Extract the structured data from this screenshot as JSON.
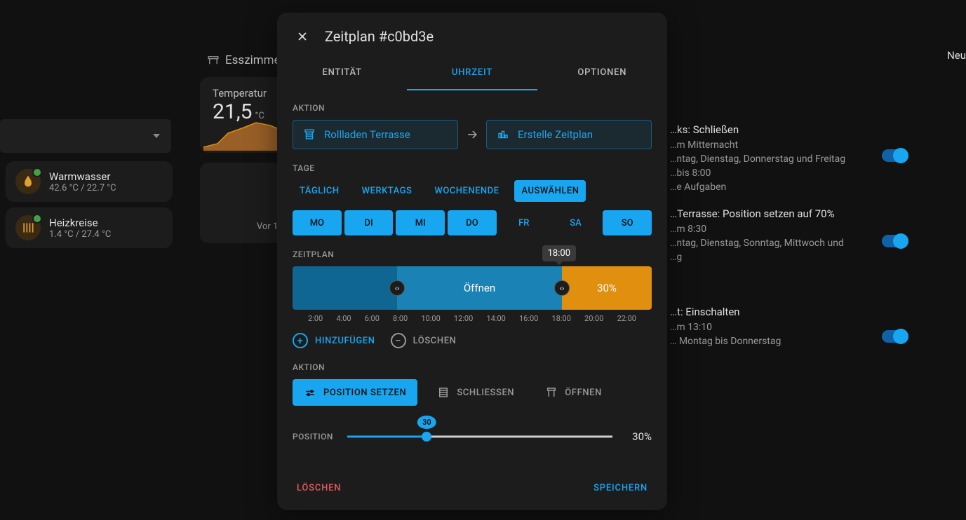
{
  "bg": {
    "room": "Esszimmer",
    "neu": "Neu",
    "temp_label": "Temperatur",
    "temp_value": "21,5",
    "temp_unit": "°C",
    "mid_time": "Vor 1…",
    "sensors": {
      "ww": {
        "name": "Warmwasser",
        "sub": "42.6 °C / 22.7 °C"
      },
      "hk": {
        "name": "Heizkreise",
        "sub": "1.4 °C / 27.4 °C"
      }
    },
    "schedules": {
      "r1": {
        "title": "…ks: Schließen",
        "l1": "…m Mitternacht",
        "l2": "…ntag, Dienstag, Donnerstag und Freitag",
        "l3": "…bis 8:00",
        "l4": "…e Aufgaben"
      },
      "r2": {
        "title": "…Terrasse: Position setzen auf 70%",
        "l1": "…m 8:30",
        "l2": "…ntag, Dienstag, Sonntag, Mittwoch und",
        "l3": "…g"
      },
      "r3": {
        "title": "…t: Einschalten",
        "l1": "…m 13:10",
        "l2": "… Montag bis Donnerstag"
      }
    }
  },
  "dialog": {
    "title": "Zeitplan #c0bd3e",
    "tabs": {
      "entity": "ENTITÄT",
      "time": "UHRZEIT",
      "options": "OPTIONEN"
    },
    "section_action": "AKTION",
    "chip_entity": "Rollladen Terrasse",
    "chip_make": "Erstelle Zeitplan",
    "section_days": "TAGE",
    "presets": {
      "daily": "TÄGLICH",
      "workdays": "WERKTAGS",
      "weekend": "WOCHENENDE",
      "select": "AUSWÄHLEN"
    },
    "days": {
      "mo": "MO",
      "di": "DI",
      "mi": "MI",
      "do": "DO",
      "fr": "FR",
      "sa": "SA",
      "so": "SO"
    },
    "section_timeline": "ZEITPLAN",
    "tl_tooltip": "18:00",
    "tl_seg_open": "Öffnen",
    "tl_seg_pct": "30%",
    "ticks": [
      "2:00",
      "4:00",
      "6:00",
      "8:00",
      "10:00",
      "12:00",
      "14:00",
      "16:00",
      "18:00",
      "20:00",
      "22:00"
    ],
    "ts_add": "HINZUFÜGEN",
    "ts_del": "LÖSCHEN",
    "section_action2": "AKTION",
    "btn_setpos": "POSITION SETZEN",
    "btn_close": "SCHLIESSEN",
    "btn_open": "ÖFFNEN",
    "slider_label": "POSITION",
    "slider_bubble": "30",
    "slider_pct": "30%",
    "footer_delete": "LÖSCHEN",
    "footer_save": "SPEICHERN"
  }
}
